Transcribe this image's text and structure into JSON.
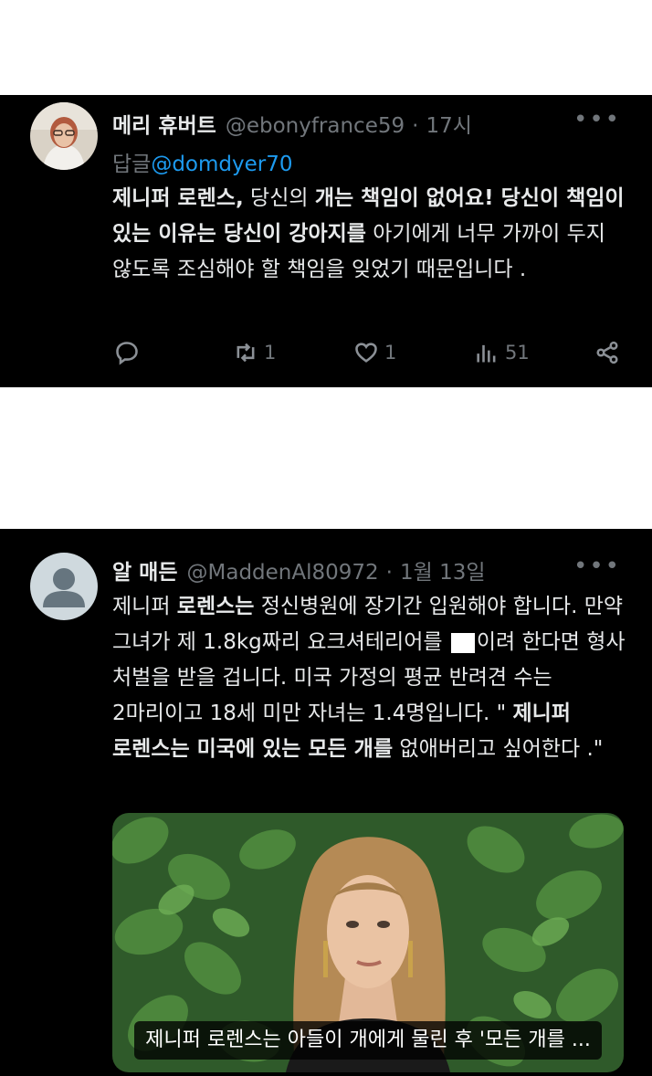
{
  "tweets": [
    {
      "display_name": "메리 휴버트",
      "handle": "@ebonyfrance59",
      "separator": "·",
      "time": "17시",
      "more": "•••",
      "reply_prefix": "답글",
      "reply_to": "@domdyer70",
      "body": {
        "s1": "제니퍼 로렌스,",
        "s2": " 당신의 ",
        "s3": "개는 책임이 없어요! 당신이 책임이 있는 이유는 당신이 강아지를",
        "s4": " 아기에게 너무 가까이 두지 않도록 조심해야 할 책임을 잊었기 때문입니다 ."
      },
      "actions": {
        "reply": "",
        "retweet": "1",
        "like": "1",
        "views": "51"
      }
    },
    {
      "display_name": "알 매든",
      "handle": "@MaddenAl80972",
      "separator": "·",
      "time": "1월 13일",
      "more": "•••",
      "body": {
        "s1": "제니퍼 ",
        "s2": "로렌스는",
        "s3": " 정신병원에 장기간 입원해야 합니다. 만약 그녀가 제 1.8kg짜리 요크셔테리어를 ",
        "s4": "이려 한다면 형사 처벌을 받을 겁니다. 미국 가정의 평균 반려견 수는 2마리이고 18세 미만 자녀는 1.4명입니다. \" ",
        "s5": "제니퍼 로렌스는 미국에 있는 모든 개를",
        "s6": " 없애버리고 싶어한다 .\""
      },
      "media_caption": "제니퍼 로렌스는 아들이 개에게 물린 후 '모든 개를 ..."
    }
  ],
  "colors": {
    "background": "#000000",
    "text": "#e7e9ea",
    "secondary": "#71767b",
    "link": "#1d9bf0"
  },
  "icons": [
    "reply-icon",
    "retweet-icon",
    "like-icon",
    "views-icon",
    "share-icon",
    "more-icon"
  ]
}
